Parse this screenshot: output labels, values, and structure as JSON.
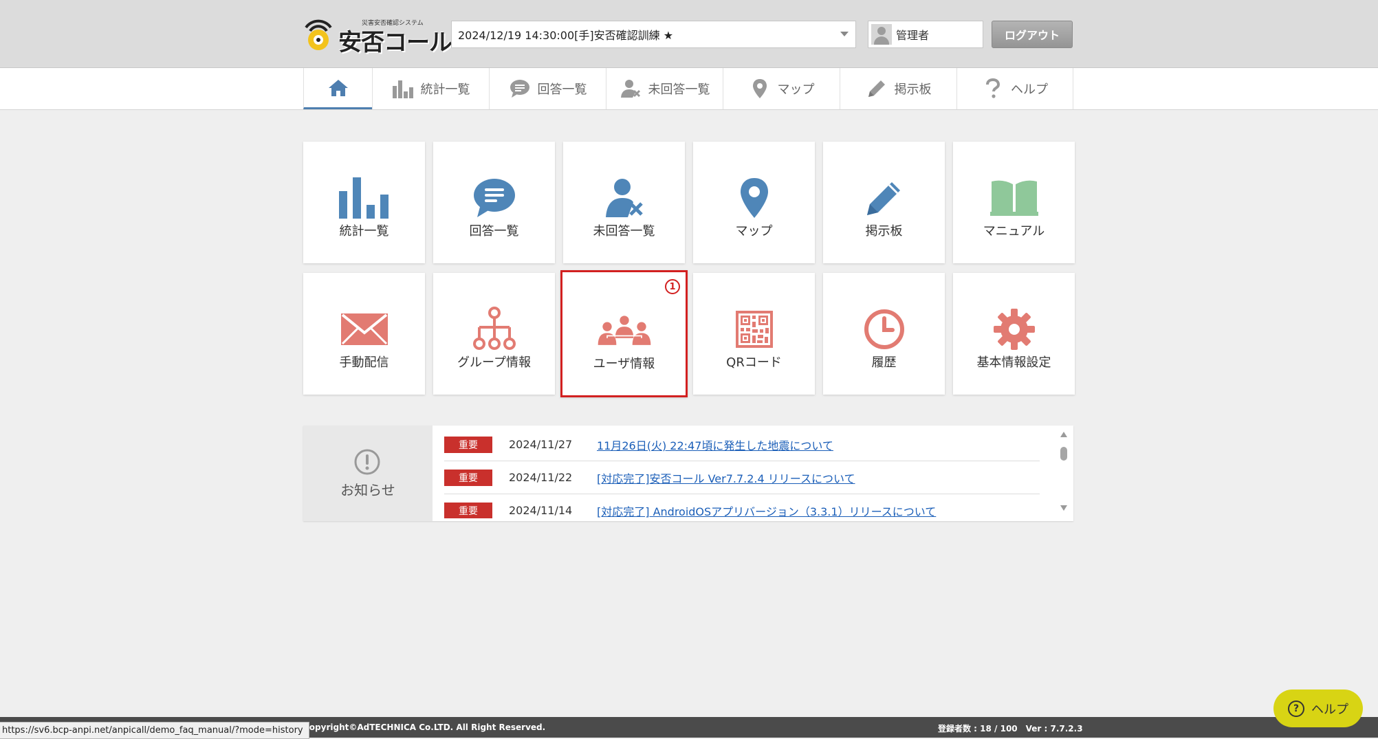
{
  "header": {
    "logo_small": "災害安否確認システム",
    "logo_main": "安否コール",
    "drill_select": "2024/12/19 14:30:00[手]安否確認訓練 ★",
    "user_name": "管理者",
    "logout_label": "ログアウト"
  },
  "nav": {
    "items": [
      {
        "label": "統計一覧"
      },
      {
        "label": "回答一覧"
      },
      {
        "label": "未回答一覧"
      },
      {
        "label": "マップ"
      },
      {
        "label": "掲示板"
      },
      {
        "label": "ヘルプ"
      }
    ]
  },
  "tiles": [
    {
      "label": "統計一覧",
      "icon": "bar-chart-icon",
      "color": "#4f86b8"
    },
    {
      "label": "回答一覧",
      "icon": "speech-bubble-icon",
      "color": "#4f86b8"
    },
    {
      "label": "未回答一覧",
      "icon": "user-x-icon",
      "color": "#4f86b8"
    },
    {
      "label": "マップ",
      "icon": "map-pin-icon",
      "color": "#4f86b8"
    },
    {
      "label": "掲示板",
      "icon": "pencil-icon",
      "color": "#4f86b8"
    },
    {
      "label": "マニュアル",
      "icon": "book-icon",
      "color": "#8fc89a"
    },
    {
      "label": "手動配信",
      "icon": "envelope-icon",
      "color": "#e27b72"
    },
    {
      "label": "グループ情報",
      "icon": "hierarchy-icon",
      "color": "#e27b72"
    },
    {
      "label": "ユーザ情報",
      "icon": "users-icon",
      "color": "#e27b72",
      "badge": "1"
    },
    {
      "label": "QRコード",
      "icon": "qr-code-icon",
      "color": "#e27b72"
    },
    {
      "label": "履歴",
      "icon": "clock-icon",
      "color": "#e27b72"
    },
    {
      "label": "基本情報設定",
      "icon": "gear-icon",
      "color": "#e27b72"
    }
  ],
  "news": {
    "heading": "お知らせ",
    "items": [
      {
        "tag": "重要",
        "date": "2024/11/27",
        "title": "11月26日(火) 22:47頃に発生した地震について"
      },
      {
        "tag": "重要",
        "date": "2024/11/22",
        "title": "[対応完了]安否コール Ver7.7.2.4 リリースについて"
      },
      {
        "tag": "重要",
        "date": "2024/11/14",
        "title": "[対応完了] AndroidOSアプリバージョン（3.3.1）リリースについて"
      }
    ]
  },
  "footer": {
    "copyright": "Copyright©AdTECHNICA Co.LTD. All Right Reserved.",
    "stats": "登録者数 : 18 / 100　Ver : 7.7.2.3"
  },
  "status_url": "https://sv6.bcp-anpi.net/anpicall/demo_faq_manual/?mode=history",
  "help_button": "ヘルプ",
  "colors": {
    "accent_blue": "#4f86b8",
    "accent_red": "#e27b72",
    "accent_green": "#8fc89a",
    "highlight": "#d22020",
    "help_yellow": "#d8d414"
  }
}
